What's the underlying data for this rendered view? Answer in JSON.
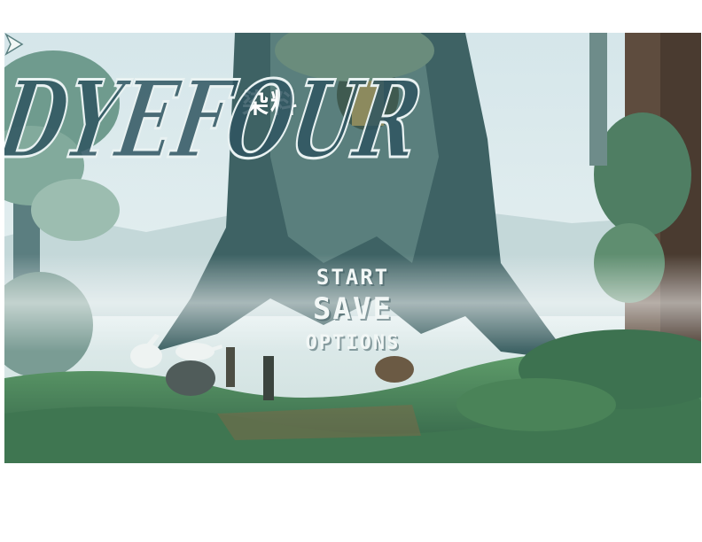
{
  "game": {
    "subtitle_kanji": "染料",
    "title": "DYEFOUR"
  },
  "menu": {
    "items": [
      "START",
      "SAVE",
      "OPTIONS"
    ],
    "selected": "SAVE",
    "cursor_icon": "arrow-right-icon"
  },
  "colors": {
    "sky": "#dcebee",
    "foliage": "#3f7a5a",
    "tree_trunk": "#3c5f63",
    "ground": "#4e8a55",
    "text": "#f2f7f6"
  }
}
